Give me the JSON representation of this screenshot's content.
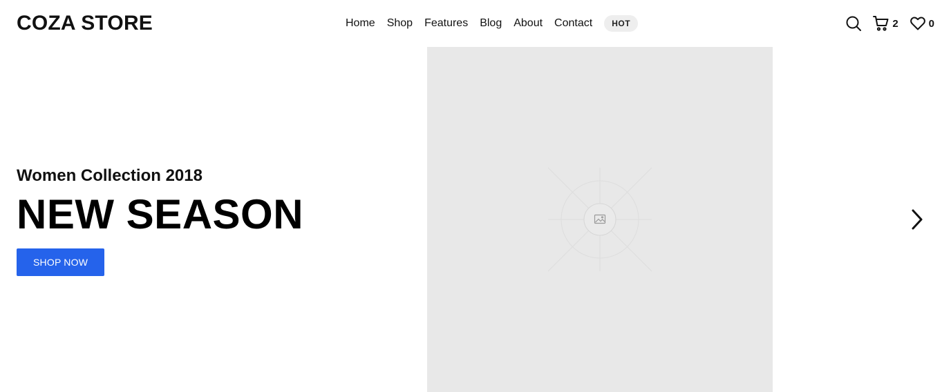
{
  "header": {
    "logo": "COZA STORE",
    "nav": [
      "Home",
      "Shop",
      "Features",
      "Blog",
      "About",
      "Contact"
    ],
    "badge": "HOT",
    "cart_count": "2",
    "wishlist_count": "0"
  },
  "hero": {
    "subtitle": "Women Collection 2018",
    "headline": "NEW SEASON",
    "cta": "SHOP NOW"
  },
  "colors": {
    "accent": "#2563eb",
    "image_placeholder": "#e8e8e8"
  },
  "icons": [
    "search-icon",
    "cart-icon",
    "heart-icon",
    "image-icon",
    "chevron-right-icon"
  ]
}
